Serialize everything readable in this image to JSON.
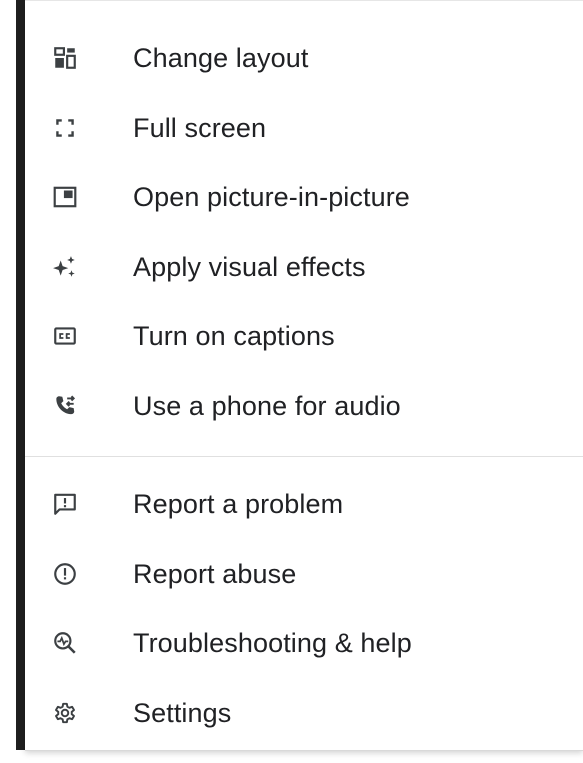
{
  "menu": {
    "group1": [
      {
        "label": "Change layout",
        "icon": "change-layout-icon"
      },
      {
        "label": "Full screen",
        "icon": "full-screen-icon"
      },
      {
        "label": "Open picture-in-picture",
        "icon": "picture-in-picture-icon"
      },
      {
        "label": "Apply visual effects",
        "icon": "visual-effects-sparkle-icon"
      },
      {
        "label": "Turn on captions",
        "icon": "closed-captions-icon"
      },
      {
        "label": "Use a phone for audio",
        "icon": "phone-audio-icon"
      }
    ],
    "group2": [
      {
        "label": "Report a problem",
        "icon": "report-problem-icon"
      },
      {
        "label": "Report abuse",
        "icon": "report-abuse-icon"
      },
      {
        "label": "Troubleshooting & help",
        "icon": "troubleshooting-icon"
      },
      {
        "label": "Settings",
        "icon": "settings-gear-icon"
      }
    ]
  },
  "colors": {
    "text": "#202124",
    "icon": "#3c4043",
    "divider": "#e0e0e0"
  }
}
